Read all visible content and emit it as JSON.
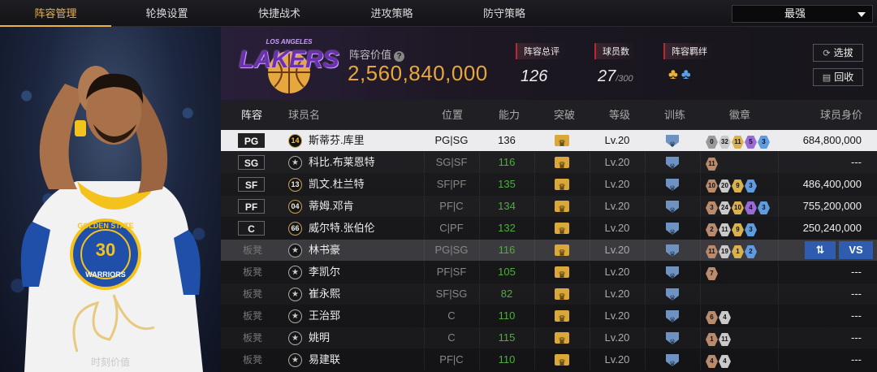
{
  "nav": {
    "tabs": [
      {
        "label": "阵容管理",
        "active": true
      },
      {
        "label": "轮换设置",
        "active": false
      },
      {
        "label": "快捷战术",
        "active": false
      },
      {
        "label": "进攻策略",
        "active": false
      },
      {
        "label": "防守策略",
        "active": false
      }
    ],
    "dropdown_value": "最强"
  },
  "card": {
    "jersey_text": "GOLDEN STATE",
    "jersey_number": "30",
    "team_text": "WARRIORS",
    "footer": "时刻价值"
  },
  "header": {
    "logo_text": "LAKERS",
    "logo_top_text": "LOS ANGELES",
    "value_label": "阵容价值",
    "value": "2,560,840,000",
    "stats": {
      "rating_label": "阵容总评",
      "rating": "126",
      "count_label": "球员数",
      "count": "27",
      "count_total": "/300",
      "bond_label": "阵容羁绊"
    },
    "buttons": {
      "scout": "选拔",
      "recycle": "回收"
    }
  },
  "table": {
    "headers": [
      "阵容",
      "球员名",
      "位置",
      "能力",
      "突破",
      "等级",
      "训练",
      "徽章",
      "球员身价"
    ],
    "rows": [
      {
        "slot": "PG",
        "jersey": "14",
        "name": "斯蒂芬.库里",
        "pos": "PG|SG",
        "ability": "136",
        "level": "Lv.20",
        "badges": [
          [
            "0",
            "b0"
          ],
          [
            "32",
            "b2"
          ],
          [
            "11",
            "b3"
          ],
          [
            "5",
            "b4"
          ],
          [
            "3",
            "b5"
          ]
        ],
        "worth": "684,800,000",
        "highlight": true
      },
      {
        "slot": "SG",
        "jersey": "★",
        "name": "科比.布莱恩特",
        "pos": "SG|SF",
        "ability": "116",
        "level": "Lv.20",
        "badges": [
          [
            "11",
            "b1"
          ]
        ],
        "worth": "---"
      },
      {
        "slot": "SF",
        "jersey": "13",
        "name": "凯文.杜兰特",
        "pos": "SF|PF",
        "ability": "135",
        "level": "Lv.20",
        "badges": [
          [
            "10",
            "b1"
          ],
          [
            "20",
            "b2"
          ],
          [
            "9",
            "b3"
          ],
          [
            "3",
            "b5"
          ]
        ],
        "worth": "486,400,000"
      },
      {
        "slot": "PF",
        "jersey": "04",
        "name": "蒂姆.邓肯",
        "pos": "PF|C",
        "ability": "134",
        "level": "Lv.20",
        "badges": [
          [
            "3",
            "b1"
          ],
          [
            "24",
            "b2"
          ],
          [
            "10",
            "b3"
          ],
          [
            "4",
            "b4"
          ],
          [
            "3",
            "b5"
          ]
        ],
        "worth": "755,200,000"
      },
      {
        "slot": "C",
        "jersey": "66",
        "name": "威尔特.张伯伦",
        "pos": "C|PF",
        "ability": "132",
        "level": "Lv.20",
        "badges": [
          [
            "2",
            "b1"
          ],
          [
            "11",
            "b2"
          ],
          [
            "9",
            "b3"
          ],
          [
            "3",
            "b5"
          ]
        ],
        "worth": "250,240,000"
      },
      {
        "slot": "板凳",
        "jersey": "★",
        "name": "林书豪",
        "pos": "PG|SG",
        "ability": "116",
        "level": "Lv.20",
        "badges": [
          [
            "11",
            "b1"
          ],
          [
            "19",
            "b2"
          ],
          [
            "1",
            "b3"
          ],
          [
            "2",
            "b5"
          ]
        ],
        "worth": "",
        "actions": {
          "swap": "⇅",
          "vs": "VS"
        }
      },
      {
        "slot": "板凳",
        "jersey": "★",
        "name": "李凯尔",
        "pos": "PF|SF",
        "ability": "105",
        "level": "Lv.20",
        "badges": [
          [
            "7",
            "b1"
          ]
        ],
        "worth": "---"
      },
      {
        "slot": "板凳",
        "jersey": "★",
        "name": "崔永熙",
        "pos": "SF|SG",
        "ability": "82",
        "level": "Lv.20",
        "badges": [],
        "worth": "---"
      },
      {
        "slot": "板凳",
        "jersey": "★",
        "name": "王治郅",
        "pos": "C",
        "ability": "110",
        "level": "Lv.20",
        "badges": [
          [
            "6",
            "b1"
          ],
          [
            "4",
            "b2"
          ]
        ],
        "worth": "---"
      },
      {
        "slot": "板凳",
        "jersey": "★",
        "name": "姚明",
        "pos": "C",
        "ability": "115",
        "level": "Lv.20",
        "badges": [
          [
            "1",
            "b1"
          ],
          [
            "11",
            "b2"
          ]
        ],
        "worth": "---"
      },
      {
        "slot": "板凳",
        "jersey": "★",
        "name": "易建联",
        "pos": "PF|C",
        "ability": "110",
        "level": "Lv.20",
        "badges": [
          [
            "4",
            "b1"
          ],
          [
            "4",
            "b2"
          ]
        ],
        "worth": "---"
      }
    ]
  },
  "colors": {
    "accent": "#e9b24a",
    "ability_green": "#4fae3c",
    "value_gold": "#e6a73e",
    "action_blue": "#2f5cae"
  }
}
